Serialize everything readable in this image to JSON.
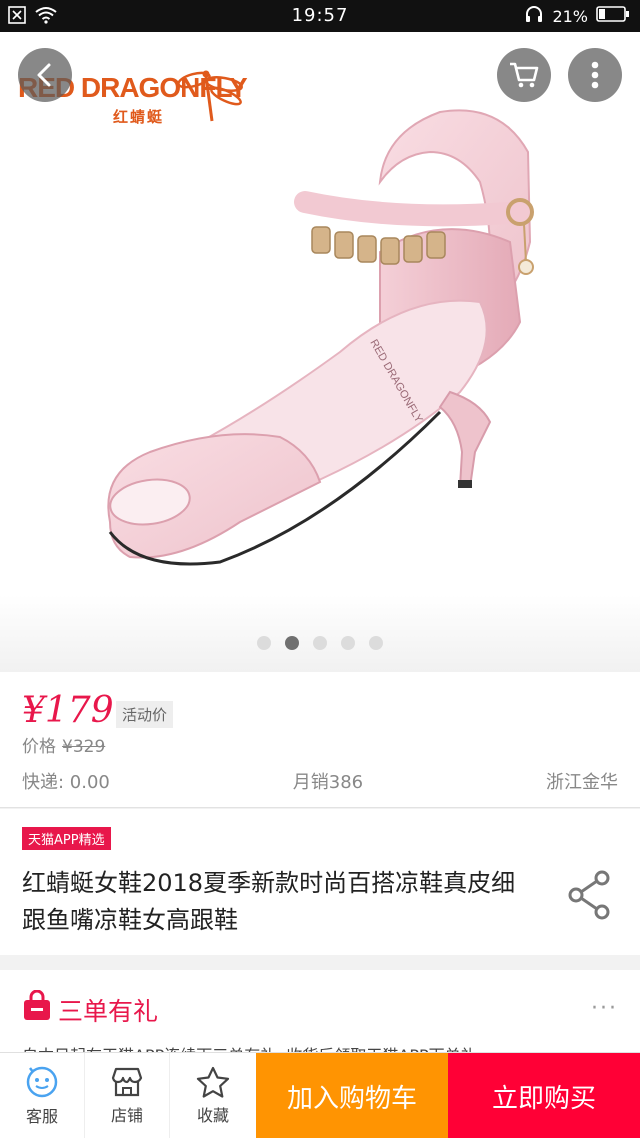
{
  "status_bar": {
    "time": "19:57",
    "battery": "21%",
    "icons": [
      "notification-icon",
      "wifi-icon",
      "headset-icon",
      "battery-icon"
    ]
  },
  "header": {
    "brand_logo_text": "RED DRAGONFLY",
    "brand_logo_cn": "红蜻蜓",
    "back_icon": "chevron-left-icon",
    "cart_icon": "cart-icon",
    "more_icon": "more-vertical-icon"
  },
  "gallery": {
    "image_alt": "pink peep-toe high heel sandal",
    "image_count": 5,
    "active_index": 1
  },
  "price": {
    "current": "¥179",
    "tag": "活动价",
    "orig_label": "价格",
    "orig_value": "¥329",
    "shipping": "快递: 0.00",
    "monthly_sales": "月销386",
    "location": "浙江金华"
  },
  "product": {
    "badge": "天猫APP精选",
    "title": "红蜻蜓女鞋2018夏季新款时尚百搭凉鞋真皮细跟鱼嘴凉鞋女高跟鞋",
    "share_icon": "share-icon"
  },
  "promo": {
    "title": "三单有礼",
    "more": "···",
    "desc": "自本日起在天猫APP连续下三单有礼, 收货后领取天猫APP下单礼"
  },
  "bottom_bar": {
    "service_label": "客服",
    "shop_label": "店铺",
    "favorite_label": "收藏",
    "add_cart_label": "加入购物车",
    "buy_now_label": "立即购买"
  },
  "colors": {
    "price_red": "#e8174b",
    "brand_orange": "#e05a1c",
    "cart_orange": "#ff9402",
    "buy_red": "#ff0036"
  }
}
